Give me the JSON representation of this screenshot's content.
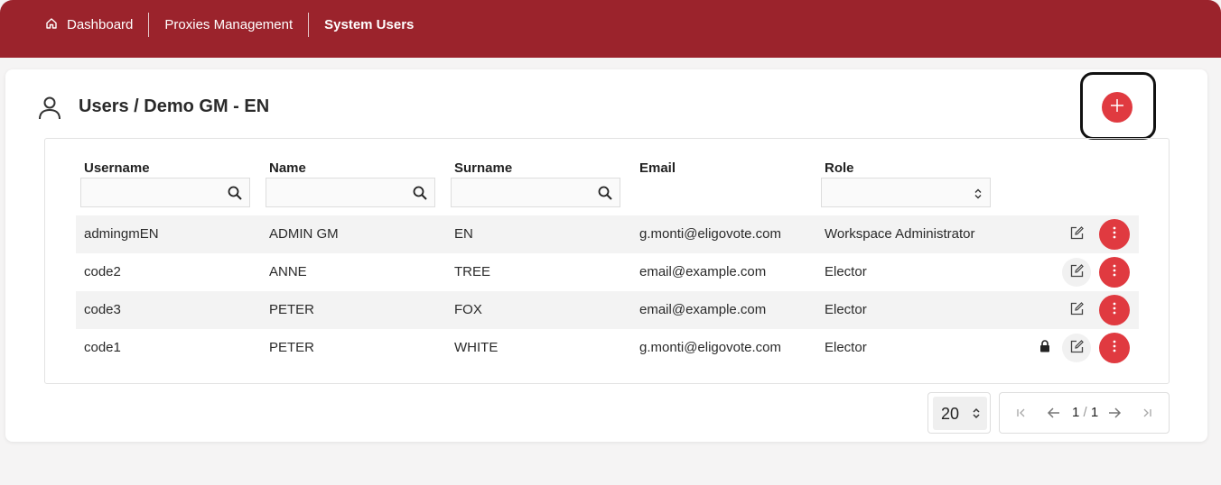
{
  "nav": {
    "home_label": "Dashboard",
    "proxies_label": "Proxies Management",
    "system_users_label": "System Users"
  },
  "page": {
    "title": "Users / Demo GM - EN"
  },
  "table": {
    "columns": {
      "username": "Username",
      "name": "Name",
      "surname": "Surname",
      "email": "Email",
      "role": "Role"
    },
    "filters": {
      "username": "",
      "name": "",
      "surname": "",
      "role_selected": ""
    },
    "rows": [
      {
        "username": "admingmEN",
        "name": "ADMIN GM",
        "surname": "EN",
        "email": "g.monti@eligovote.com",
        "role": "Workspace Administrator",
        "locked": false
      },
      {
        "username": "code2",
        "name": "ANNE",
        "surname": "TREE",
        "email": "email@example.com",
        "role": "Elector",
        "locked": false
      },
      {
        "username": "code3",
        "name": "PETER",
        "surname": "FOX",
        "email": "email@example.com",
        "role": "Elector",
        "locked": false
      },
      {
        "username": "code1",
        "name": "PETER",
        "surname": "WHITE",
        "email": "g.monti@eligovote.com",
        "role": "Elector",
        "locked": true
      }
    ]
  },
  "pagination": {
    "page_size": "20",
    "current_page": "1",
    "separator": "/",
    "total_pages": "1"
  },
  "icons": {
    "home": "home-icon",
    "user": "user-icon",
    "add": "plus-icon",
    "search": "search-icon",
    "select": "updown-icon",
    "edit": "edit-icon",
    "more": "more-vertical-icon",
    "lock": "lock-icon",
    "first": "first-page-icon",
    "prev": "arrow-left-icon",
    "next": "arrow-right-icon",
    "last": "last-page-icon"
  },
  "colors": {
    "header": "#9b232c",
    "accent": "#e03a40",
    "row_shade": "#f3f3f3"
  }
}
